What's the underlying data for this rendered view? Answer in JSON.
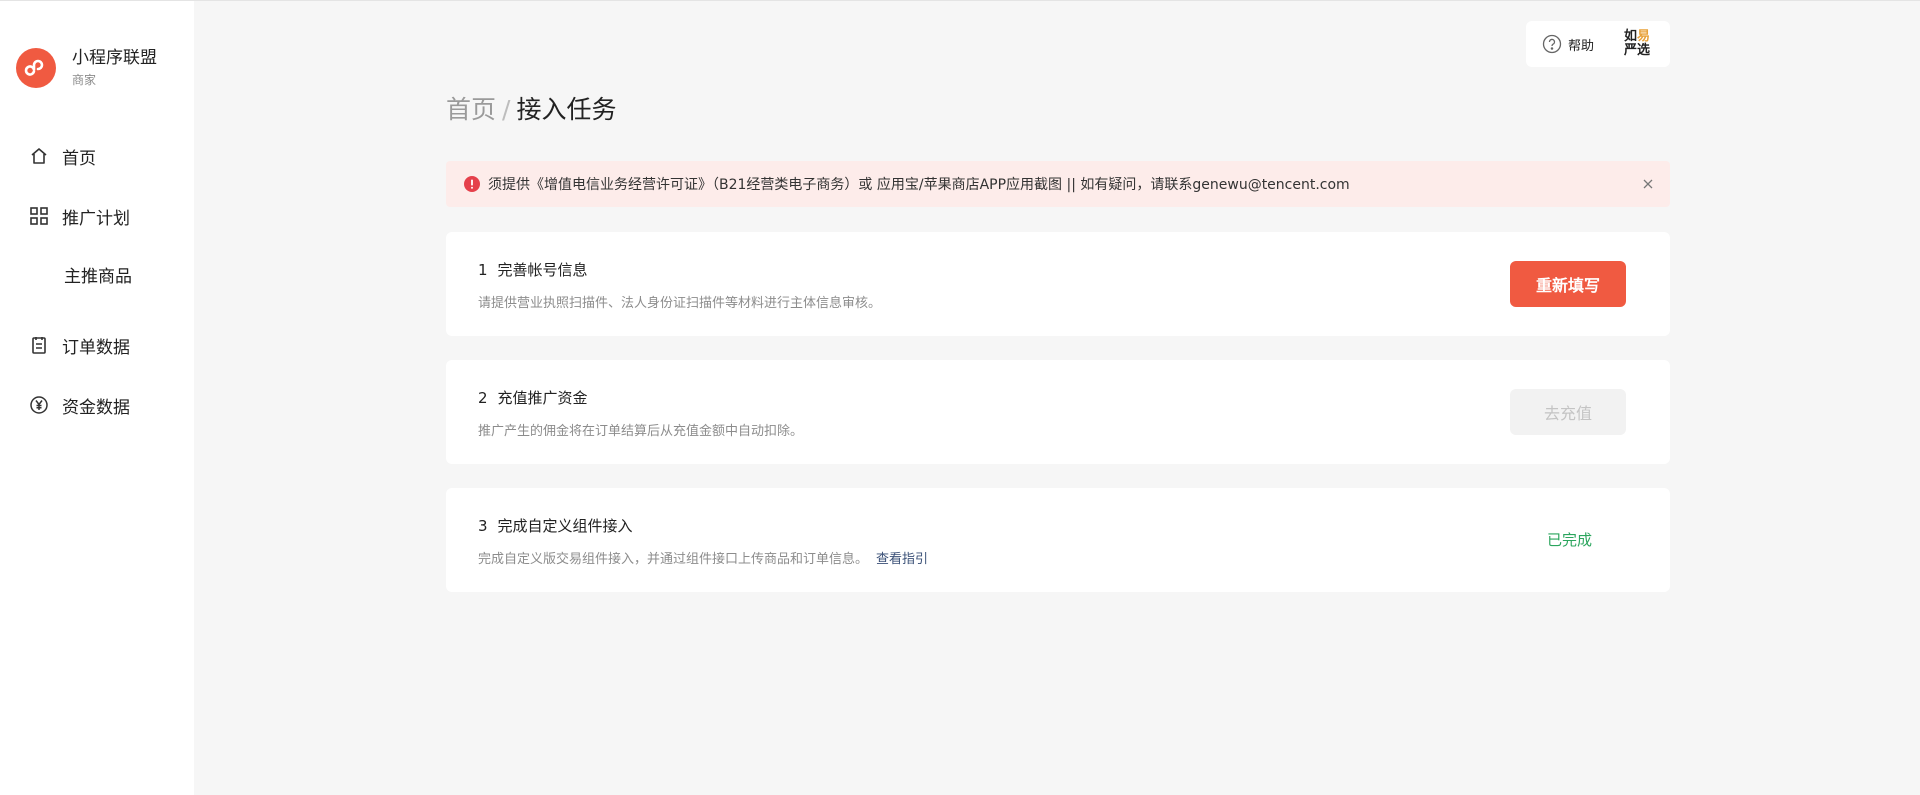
{
  "brand": {
    "name": "小程序联盟",
    "sub": "商家",
    "icon": "mini-program-logo-icon",
    "color": "#f05a41"
  },
  "nav": {
    "home": {
      "label": "首页",
      "icon": "home-icon"
    },
    "promo": {
      "label": "推广计划",
      "icon": "grid-icon"
    },
    "featured": {
      "label": "主推商品"
    },
    "orders": {
      "label": "订单数据",
      "icon": "clipboard-icon"
    },
    "funds": {
      "label": "资金数据",
      "icon": "yen-icon"
    }
  },
  "topbar": {
    "help_label": "帮助",
    "store_logo_line1a": "如",
    "store_logo_line1b": "易",
    "store_logo_line2": "严选"
  },
  "breadcrumb": {
    "home": "首页",
    "separator": "/",
    "current": "接入任务"
  },
  "alert": {
    "text": "须提供《增值电信业务经营许可证》（B21经营类电子商务）或 应用宝/苹果商店APP应用截图 || 如有疑问，请联系genewu@tencent.com",
    "color": "#fdecea"
  },
  "tasks": [
    {
      "num": "1",
      "title": "完善帐号信息",
      "desc": "请提供营业执照扫描件、法人身份证扫描件等材料进行主体信息审核。",
      "action": "重新填写"
    },
    {
      "num": "2",
      "title": "充值推广资金",
      "desc": "推广产生的佣金将在订单结算后从充值金额中自动扣除。",
      "action": "去充值"
    },
    {
      "num": "3",
      "title": "完成自定义组件接入",
      "desc": "完成自定义版交易组件接入，并通过组件接口上传商品和订单信息。",
      "link": "查看指引",
      "status": "已完成"
    }
  ],
  "colors": {
    "accent": "#f05a41",
    "success": "#2ba55d",
    "link": "#3a5077"
  }
}
